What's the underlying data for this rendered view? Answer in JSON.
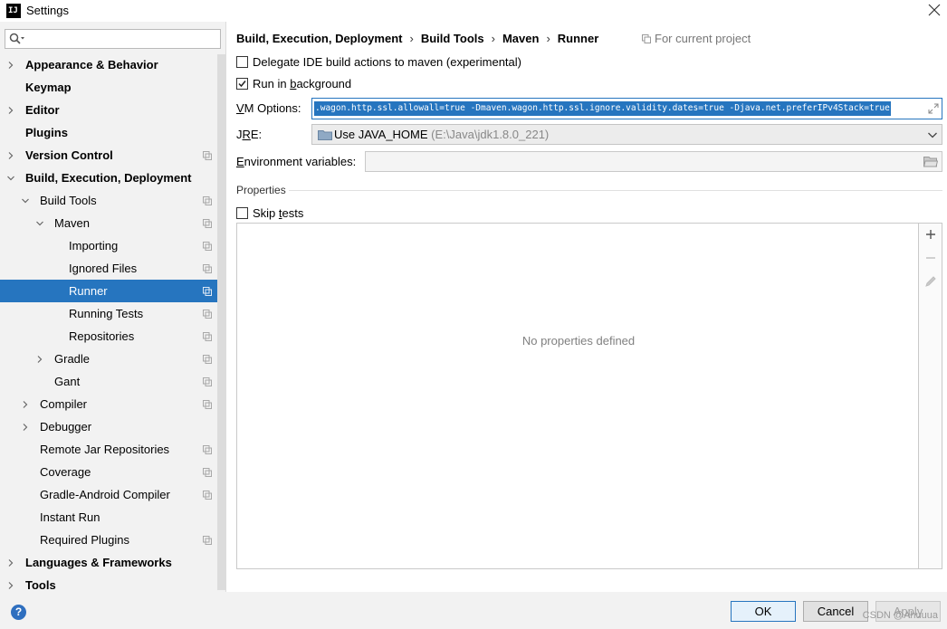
{
  "window": {
    "title": "Settings",
    "app_icon": "IJ"
  },
  "search": {
    "placeholder": ""
  },
  "sidebar": {
    "items": [
      {
        "label": "Appearance & Behavior",
        "bold": true,
        "level": 0,
        "arrow": "right",
        "copy_icon": false
      },
      {
        "label": "Keymap",
        "bold": true,
        "level": 0,
        "arrow": "none",
        "copy_icon": false
      },
      {
        "label": "Editor",
        "bold": true,
        "level": 0,
        "arrow": "right",
        "copy_icon": false
      },
      {
        "label": "Plugins",
        "bold": true,
        "level": 0,
        "arrow": "none",
        "copy_icon": false
      },
      {
        "label": "Version Control",
        "bold": true,
        "level": 0,
        "arrow": "right",
        "copy_icon": true
      },
      {
        "label": "Build, Execution, Deployment",
        "bold": true,
        "level": 0,
        "arrow": "down",
        "copy_icon": false
      },
      {
        "label": "Build Tools",
        "bold": false,
        "level": 1,
        "arrow": "down",
        "copy_icon": true
      },
      {
        "label": "Maven",
        "bold": false,
        "level": 2,
        "arrow": "down",
        "copy_icon": true
      },
      {
        "label": "Importing",
        "bold": false,
        "level": 3,
        "arrow": "none",
        "copy_icon": true
      },
      {
        "label": "Ignored Files",
        "bold": false,
        "level": 3,
        "arrow": "none",
        "copy_icon": true
      },
      {
        "label": "Runner",
        "bold": false,
        "level": 3,
        "arrow": "none",
        "copy_icon": true,
        "selected": true
      },
      {
        "label": "Running Tests",
        "bold": false,
        "level": 3,
        "arrow": "none",
        "copy_icon": true
      },
      {
        "label": "Repositories",
        "bold": false,
        "level": 3,
        "arrow": "none",
        "copy_icon": true
      },
      {
        "label": "Gradle",
        "bold": false,
        "level": 2,
        "arrow": "right",
        "copy_icon": true
      },
      {
        "label": "Gant",
        "bold": false,
        "level": 2,
        "arrow": "none",
        "copy_icon": true
      },
      {
        "label": "Compiler",
        "bold": false,
        "level": 1,
        "arrow": "right",
        "copy_icon": true
      },
      {
        "label": "Debugger",
        "bold": false,
        "level": 1,
        "arrow": "right",
        "copy_icon": false
      },
      {
        "label": "Remote Jar Repositories",
        "bold": false,
        "level": 1,
        "arrow": "none",
        "copy_icon": true
      },
      {
        "label": "Coverage",
        "bold": false,
        "level": 1,
        "arrow": "none",
        "copy_icon": true
      },
      {
        "label": "Gradle-Android Compiler",
        "bold": false,
        "level": 1,
        "arrow": "none",
        "copy_icon": true
      },
      {
        "label": "Instant Run",
        "bold": false,
        "level": 1,
        "arrow": "none",
        "copy_icon": false
      },
      {
        "label": "Required Plugins",
        "bold": false,
        "level": 1,
        "arrow": "none",
        "copy_icon": true
      },
      {
        "label": "Languages & Frameworks",
        "bold": true,
        "level": 0,
        "arrow": "right",
        "copy_icon": false
      },
      {
        "label": "Tools",
        "bold": true,
        "level": 0,
        "arrow": "right",
        "copy_icon": false
      }
    ]
  },
  "breadcrumb": {
    "items": [
      "Build, Execution, Deployment",
      "Build Tools",
      "Maven",
      "Runner"
    ],
    "separator": "›",
    "for_project": "For current project"
  },
  "options": {
    "delegate": {
      "label_pre": "Delegate IDE build actions to maven (experimental)",
      "checked": false
    },
    "background": {
      "label_pre": "Run in ",
      "label_u": "b",
      "label_post": "ackground",
      "checked": true
    },
    "vm_label_u": "V",
    "vm_label_rest": "M Options:",
    "vm_value": ".wagon.http.ssl.allowall=true -Dmaven.wagon.http.ssl.ignore.validity.dates=true -Djava.net.preferIPv4Stack=true",
    "jre_label_pre": "J",
    "jre_label_u": "R",
    "jre_label_post": "E:",
    "jre_value": "Use JAVA_HOME",
    "jre_path": "(E:\\Java\\jdk1.8.0_221)",
    "env_label_u": "E",
    "env_label_rest": "nvironment variables:",
    "env_value": ""
  },
  "properties": {
    "section_title": "Properties",
    "skip_tests": {
      "label_pre": "Skip ",
      "label_u": "t",
      "label_post": "ests",
      "checked": false
    },
    "empty_text": "No properties defined"
  },
  "footer": {
    "help": "?",
    "ok": "OK",
    "cancel": "Cancel",
    "apply": "Apply",
    "watermark": "CSDN @Ahuuua"
  },
  "colors": {
    "accent": "#2675bf",
    "sidebar_bg": "#f2f2f2"
  }
}
